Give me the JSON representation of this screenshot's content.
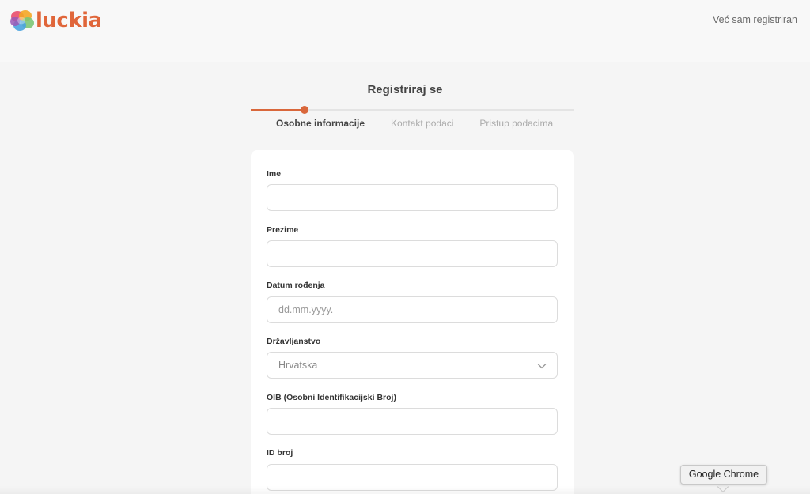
{
  "header": {
    "brand": "luckia",
    "login_link": "Već sam registriran"
  },
  "registration": {
    "title": "Registriraj se",
    "progress_fraction": 0.167,
    "steps": [
      {
        "label": "Osobne informacije",
        "active": true
      },
      {
        "label": "Kontakt podaci",
        "active": false
      },
      {
        "label": "Pristup podacima",
        "active": false
      }
    ]
  },
  "form": {
    "first_name": {
      "label": "Ime",
      "value": "",
      "placeholder": ""
    },
    "last_name": {
      "label": "Prezime",
      "value": "",
      "placeholder": ""
    },
    "birth_date": {
      "label": "Datum rođenja",
      "value": "",
      "placeholder": "dd.mm.yyyy."
    },
    "citizenship": {
      "label": "Državljanstvo",
      "value": "Hrvatska"
    },
    "oib": {
      "label": "OIB (Osobni Identifikacijski Broj)",
      "value": "",
      "placeholder": ""
    },
    "id_number": {
      "label": "ID broj",
      "value": "",
      "placeholder": ""
    }
  },
  "tooltip": {
    "text": "Google Chrome"
  },
  "colors": {
    "accent": "#d9673b",
    "brand_text": "#e0663a",
    "background": "#f5f5f5",
    "card": "#ffffff"
  },
  "icons": [
    "luckia-logo-icon",
    "chevron-down-icon"
  ]
}
